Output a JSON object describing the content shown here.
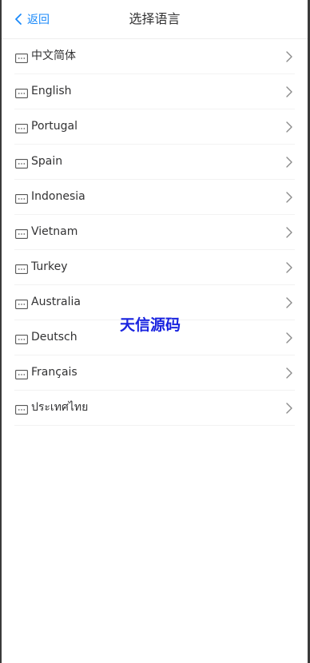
{
  "header": {
    "back_label": "返回",
    "title": "选择语言"
  },
  "languages": [
    {
      "label": "中文简体"
    },
    {
      "label": "English"
    },
    {
      "label": "Portugal"
    },
    {
      "label": "Spain"
    },
    {
      "label": "Indonesia"
    },
    {
      "label": "Vietnam"
    },
    {
      "label": "Turkey"
    },
    {
      "label": "Australia"
    },
    {
      "label": "Deutsch"
    },
    {
      "label": "Français"
    },
    {
      "label": "ประเทศไทย"
    }
  ],
  "watermark": "天信源码",
  "colors": {
    "accent": "#1989fa",
    "text": "#323233",
    "watermark": "#1a24e0"
  },
  "icons": {
    "back": "chevron-left-icon",
    "row": "keyboard-icon",
    "row_arrow": "chevron-right-icon"
  }
}
